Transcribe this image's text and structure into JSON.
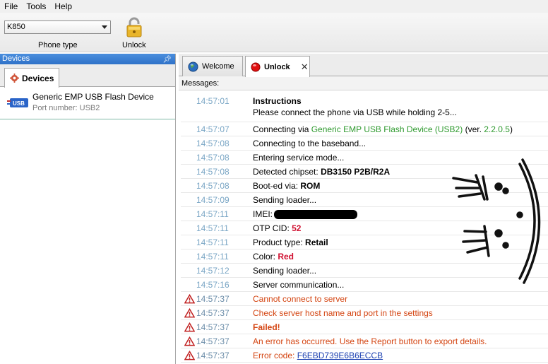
{
  "menu": [
    "File",
    "Tools",
    "Help"
  ],
  "toolbar": {
    "phone_model": "K850",
    "phone_type_label": "Phone type",
    "unlock_label": "Unlock"
  },
  "devices_panel": {
    "header": "Devices",
    "tab_label": "Devices",
    "device": {
      "name": "Generic EMP USB Flash Device",
      "port": "Port number: USB2",
      "icon_text": "USB"
    }
  },
  "tabs": {
    "welcome": "Welcome",
    "unlock": "Unlock"
  },
  "messages_label": "Messages:",
  "messages": [
    {
      "time": "14:57:01",
      "title": "Instructions",
      "text": "Please connect the phone via USB while holding 2-5..."
    },
    {
      "time": "14:57:07",
      "prefix": "Connecting via ",
      "device": "Generic EMP USB Flash Device (USB2)",
      "mid": " (ver. ",
      "version": "2.2.0.5",
      "suffix": ")"
    },
    {
      "time": "14:57:08",
      "text": "Connecting to the baseband..."
    },
    {
      "time": "14:57:08",
      "text": "Entering service mode..."
    },
    {
      "time": "14:57:08",
      "label": "Detected chipset: ",
      "value": "DB3150 P2B/R2A"
    },
    {
      "time": "14:57:08",
      "label": "Boot-ed via: ",
      "value": "ROM"
    },
    {
      "time": "14:57:09",
      "text": "Sending loader..."
    },
    {
      "time": "14:57:11",
      "label": "IMEI:"
    },
    {
      "time": "14:57:11",
      "label": "OTP CID: ",
      "value": "52"
    },
    {
      "time": "14:57:11",
      "label": "Product type: ",
      "value": "Retail"
    },
    {
      "time": "14:57:11",
      "label": "Color: ",
      "value": "Red"
    },
    {
      "time": "14:57:12",
      "text": "Sending loader..."
    },
    {
      "time": "14:57:16",
      "text": "Server communication..."
    },
    {
      "time": "14:57:37",
      "text": "Cannot connect to server"
    },
    {
      "time": "14:57:37",
      "text": "Check server host name and port in the settings"
    },
    {
      "time": "14:57:37",
      "text": "Failed!"
    },
    {
      "time": "14:57:37",
      "text": "An error has occurred. Use the Report button to export details."
    },
    {
      "time": "14:57:37",
      "label": "Error code: ",
      "value": "F6EBD739E6B6ECCB"
    }
  ],
  "colors": {
    "time": "#7aa6c5",
    "error_text": "#d44512",
    "accent_green": "#2f9a2f",
    "accent_red": "#d01030",
    "link": "#1a3fb0",
    "panel_header": "#2f72c8"
  },
  "icons": [
    "lock-icon",
    "gear-icon",
    "usb-icon",
    "globe-icon",
    "record-icon",
    "warning-icon",
    "pin-icon",
    "close-icon"
  ]
}
